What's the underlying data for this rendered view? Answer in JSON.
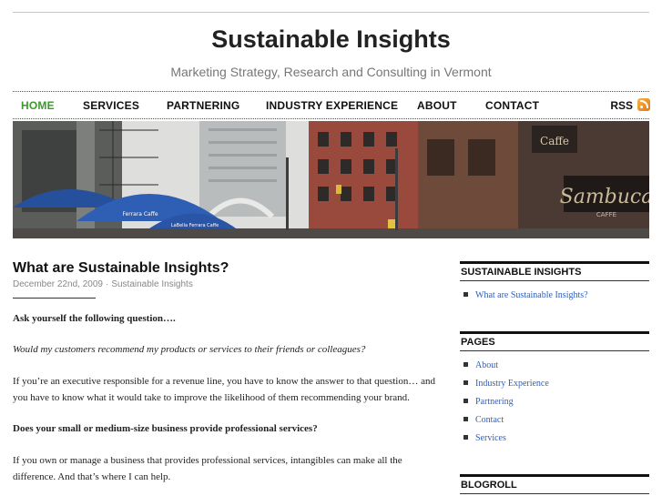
{
  "site": {
    "title": "Sustainable Insights",
    "tagline": "Marketing Strategy, Research and Consulting in Vermont"
  },
  "nav": {
    "items": [
      {
        "label": "HOME",
        "active": true
      },
      {
        "label": "SERVICES",
        "active": false
      },
      {
        "label": "PARTNERING",
        "active": false
      },
      {
        "label": "INDUSTRY EXPERIENCE",
        "active": false
      },
      {
        "label": "ABOUT",
        "active": false
      },
      {
        "label": "CONTACT",
        "active": false
      }
    ],
    "rss_label": "RSS",
    "rss_icon": "rss-feed-icon",
    "active_color": "#3a9a2a"
  },
  "header_image": {
    "signs": [
      "Ferrara Caffe",
      "LaBella Ferrara Caffe",
      "Caffe",
      "Sambuca",
      "CAFFE"
    ]
  },
  "post": {
    "title": "What are Sustainable Insights?",
    "date": "December 22nd, 2009",
    "meta_separator": "·",
    "category": "Sustainable Insights",
    "paragraphs": [
      "Ask yourself the following question….",
      "Would my customers recommend my products or services to their friends or colleagues?",
      "If you’re an executive responsible for a revenue line, you have to know the answer to that question… and",
      "you have to know what it would take to improve the likelihood of them recommending your brand.",
      "Does your small or medium-size business provide professional services?",
      "If you own or manage a business that provides professional services, intangibles can make all the",
      "difference. And that’s where I can help."
    ]
  },
  "sidebar": {
    "recent_title": "SUSTAINABLE INSIGHTS",
    "recent_links": [
      "What are Sustainable Insights?"
    ],
    "pages_title": "PAGES",
    "pages_links": [
      "About",
      "Industry Experience",
      "Partnering",
      "Contact",
      "Services"
    ],
    "blogroll_title": "BLOGROLL"
  },
  "colors": {
    "link": "#2d5fbf",
    "meta": "#888888"
  }
}
